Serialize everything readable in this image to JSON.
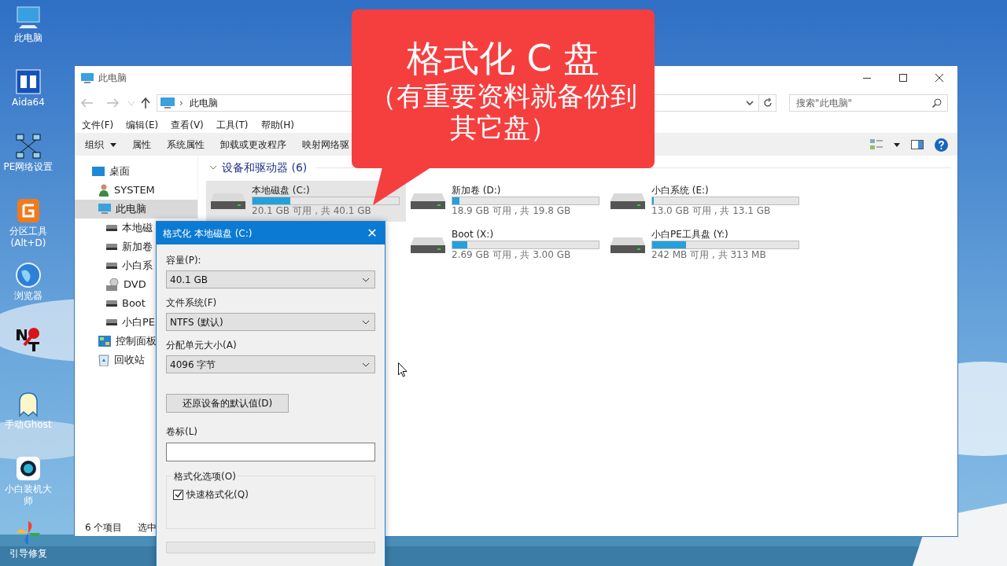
{
  "desktop_icons": [
    {
      "kind": "pc",
      "lines": [
        "此电脑"
      ]
    },
    {
      "kind": "aida",
      "lines": [
        "Aida64"
      ]
    },
    {
      "kind": "network",
      "lines": [
        "PE网络设置"
      ]
    },
    {
      "kind": "partition",
      "lines": [
        "分区工具",
        "(Alt+D)"
      ]
    },
    {
      "kind": "browser",
      "lines": [
        "浏览器"
      ]
    },
    {
      "kind": "nt"
    },
    {
      "kind": "ghost",
      "lines": [
        "手动Ghost"
      ]
    },
    {
      "kind": "installer",
      "lines": [
        "小白装机大",
        "师"
      ]
    },
    {
      "kind": "repair",
      "lines": [
        "引导修复"
      ]
    }
  ],
  "explorer": {
    "title": "此电脑",
    "address": {
      "separator": "›",
      "path": "此电脑"
    },
    "search": {
      "placeholder": "搜索\"此电脑\""
    },
    "menu": [
      "文件(F)",
      "编辑(E)",
      "查看(V)",
      "工具(T)",
      "帮助(H)"
    ],
    "toolbar": [
      {
        "label": "组织",
        "caret": true
      },
      {
        "label": "属性",
        "caret": false
      },
      {
        "label": "系统属性",
        "caret": false
      },
      {
        "label": "卸载或更改程序",
        "caret": false
      },
      {
        "label": "映射网络驱",
        "caret": false
      }
    ],
    "nav": [
      {
        "kind": "desktop",
        "label": "桌面",
        "selected": false,
        "children": [
          {
            "kind": "user",
            "label": "SYSTEM",
            "selected": false
          },
          {
            "kind": "pc",
            "label": "此电脑",
            "selected": true,
            "children": [
              {
                "kind": "drive",
                "label": "本地磁",
                "selected": false
              },
              {
                "kind": "drive",
                "label": "新加卷",
                "selected": false
              },
              {
                "kind": "drive",
                "label": "小白系",
                "selected": false
              },
              {
                "kind": "dvd",
                "label": "DVD",
                "selected": false
              },
              {
                "kind": "drive",
                "label": "Boot",
                "selected": false
              },
              {
                "kind": "drive",
                "label": "小白PE",
                "selected": false
              }
            ]
          },
          {
            "kind": "control",
            "label": "控制面板",
            "selected": false
          },
          {
            "kind": "recycle",
            "label": "回收站",
            "selected": false
          }
        ]
      }
    ],
    "section": {
      "title": "设备和驱动器 (6)",
      "expanded": true
    },
    "drives": [
      {
        "name": "本地磁盘 (C:)",
        "level": 0.26,
        "info": "20.1 GB 可用，共 40.1 GB",
        "selected": true
      },
      {
        "name": "新加卷 (D:)",
        "level": 0.05,
        "info": "18.9 GB 可用 , 共 19.8 GB",
        "selected": false
      },
      {
        "name": "小白系统 (E:)",
        "level": 0.01,
        "info": "13.0 GB 可用 , 共 13.1 GB",
        "selected": false
      },
      {
        "name": "Boot (X:)",
        "level": 0.1,
        "info": "2.69 GB 可用 , 共 3.00 GB",
        "selected": false
      },
      {
        "name": "小白PE工具盘 (Y:)",
        "level": 0.23,
        "info": "242 MB 可用 , 共 313 MB",
        "selected": false
      }
    ],
    "status": [
      "6 个项目",
      "选中"
    ]
  },
  "format_dialog": {
    "title": "格式化 本地磁盘 (C:)",
    "close": "✕",
    "fields": [
      {
        "label": "容量(P):",
        "value": "40.1 GB"
      },
      {
        "label": "文件系统(F)",
        "value": "NTFS (默认)"
      },
      {
        "label": "分配单元大小(A)",
        "value": "4096 字节"
      }
    ],
    "restore_button": "还原设备的默认值(D)",
    "volume_label": {
      "label": "卷标(L)"
    },
    "options": {
      "title": "格式化选项(O)",
      "items": [
        {
          "label": "快速格式化(Q)",
          "checked": true
        }
      ]
    },
    "progress": {
      "level": 0
    }
  },
  "callout": {
    "title": "格式化 C 盘",
    "subtitle": "（有重要资料就备份到其它盘）"
  }
}
